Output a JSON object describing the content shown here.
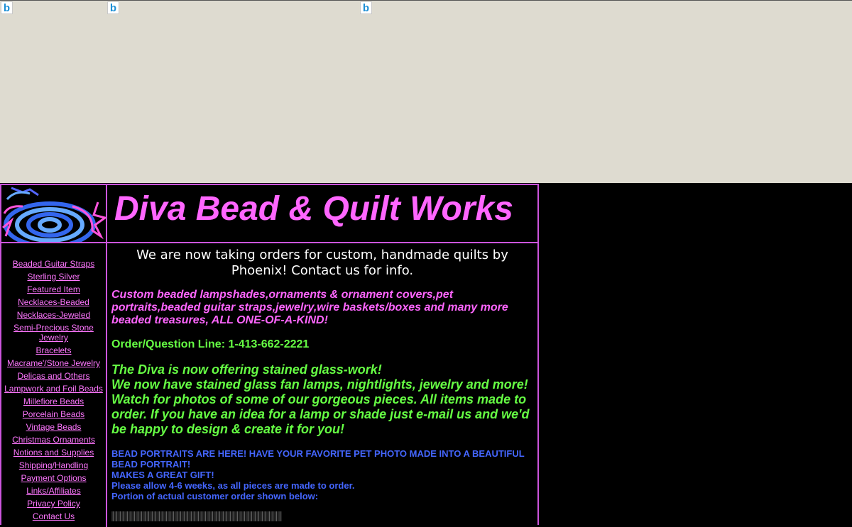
{
  "site": {
    "title": "Diva Bead & Quilt Works"
  },
  "ad_icons": [
    "bing-ad-icon",
    "bing-ad-icon",
    "bing-ad-icon"
  ],
  "nav": [
    {
      "label": "Beaded Guitar Straps"
    },
    {
      "label": "Sterling Silver"
    },
    {
      "label": "Featured Item"
    },
    {
      "label": "Necklaces-Beaded"
    },
    {
      "label": "Necklaces-Jeweled"
    },
    {
      "label": "Semi-Precious Stone Jewelry"
    },
    {
      "label": "Bracelets"
    },
    {
      "label": "Macrame'/Stone Jewelry"
    },
    {
      "label": "Delicas and Others"
    },
    {
      "label": "Lampwork and Foil Beads"
    },
    {
      "label": "Millefiore Beads"
    },
    {
      "label": "Porcelain Beads"
    },
    {
      "label": "Vintage Beads"
    },
    {
      "label": "Christmas Ornaments"
    },
    {
      "label": "Notions and Supplies"
    },
    {
      "label": "Shipping/Handling"
    },
    {
      "label": "Payment Options"
    },
    {
      "label": "Links/Affiliates"
    },
    {
      "label": "Privacy Policy"
    },
    {
      "label": "Contact Us"
    }
  ],
  "content": {
    "announcement": "We are now taking orders for custom, handmade quilts by Phoenix!  Contact us for info.",
    "products": "Custom beaded lampshades,ornaments & ornament covers,pet portraits,beaded guitar straps,jewelry,wire baskets/boxes and many more beaded treasures, ALL ONE-OF-A-KIND!",
    "phone": "Order/Question Line: 1-413-662-2221",
    "stained_1": "The Diva is now offering stained glass-work!",
    "stained_2": "We now have stained glass fan lamps, nightlights, jewelry and more! Watch for photos of some of our gorgeous pieces. All items made to order. If you have an idea for a lamp or shade just e-mail us and we'd be happy to design & create it for you!",
    "portraits_1": "BEAD PORTRAITS ARE HERE! HAVE YOUR FAVORITE PET PHOTO MADE INTO A BEAUTIFUL BEAD PORTRAIT!",
    "portraits_2": "MAKES A GREAT GIFT!",
    "portraits_3": "Please allow 4-6 weeks, as all pieces are made to order.",
    "portraits_4": "Portion of actual customer order shown below:"
  },
  "colors": {
    "accent_pink": "#ff66ff",
    "green": "#66ff44",
    "blue": "#4466ff",
    "border": "#cc55dd",
    "ad_background": "#dedbd0"
  }
}
